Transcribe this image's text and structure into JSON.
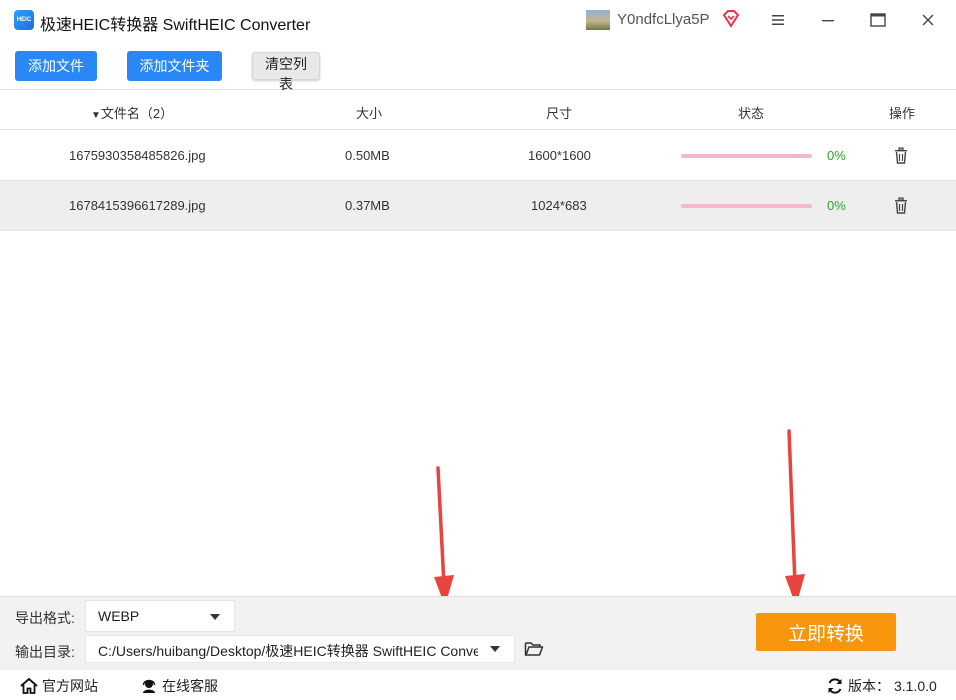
{
  "app": {
    "title": "极速HEIC转换器 SwiftHEIC Converter",
    "logo_text": "HEIC",
    "user_name": "Y0ndfcLlya5P"
  },
  "toolbar": {
    "add_file": "添加文件",
    "add_folder": "添加文件夹",
    "clear_list": "清空列表"
  },
  "table": {
    "headers": {
      "filename": "文件名（2）",
      "size": "大小",
      "dimensions": "尺寸",
      "status": "状态",
      "actions": "操作"
    },
    "rows": [
      {
        "filename": "1675930358485826.jpg",
        "size": "0.50MB",
        "dimensions": "1600*1600",
        "progress": "0%"
      },
      {
        "filename": "1678415396617289.jpg",
        "size": "0.37MB",
        "dimensions": "1024*683",
        "progress": "0%"
      }
    ]
  },
  "bottom": {
    "format_label": "导出格式:",
    "format_value": "WEBP",
    "output_label": "输出目录:",
    "output_value": "C:/Users/huibang/Desktop/极速HEIC转换器 SwiftHEIC Converter",
    "convert_button": "立即转换"
  },
  "footer": {
    "website": "官方网站",
    "support": "在线客服",
    "version_label": "版本：",
    "version_value": "3.1.0.0"
  },
  "colors": {
    "primary_blue": "#2a88f6",
    "convert_orange": "#f7960d",
    "progress_pink": "#f4b9c8",
    "percent_green": "#2aa52a",
    "arrow_red": "#e8433e"
  }
}
